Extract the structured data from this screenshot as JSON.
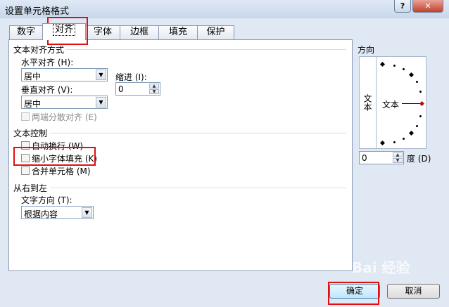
{
  "window": {
    "title": "设置单元格格式",
    "help": "?",
    "close": "✕"
  },
  "tabs": [
    "数字",
    "对齐",
    "字体",
    "边框",
    "填充",
    "保护"
  ],
  "alignment": {
    "group_title": "文本对齐方式",
    "horizontal_label": "水平对齐 (H):",
    "horizontal_value": "居中",
    "indent_label": "缩进 (I):",
    "indent_value": "0",
    "vertical_label": "垂直对齐 (V):",
    "vertical_value": "居中",
    "distributed_label": "两端分散对齐 (E)"
  },
  "text_control": {
    "group_title": "文本控制",
    "wrap_label": "自动换行 (W)",
    "shrink_label": "缩小字体填充 (K)",
    "merge_label": "合并单元格 (M)"
  },
  "rtl": {
    "group_title": "从右到左",
    "direction_label": "文字方向 (T):",
    "direction_value": "根据内容"
  },
  "orientation": {
    "group_title": "方向",
    "vertical_text": "文本",
    "dial_text": "文本",
    "degree_value": "0",
    "degree_label": "度 (D)"
  },
  "buttons": {
    "ok": "确定",
    "cancel": "取消"
  },
  "watermark": "Bai 经验",
  "colors": {
    "highlight": "#e01010"
  }
}
